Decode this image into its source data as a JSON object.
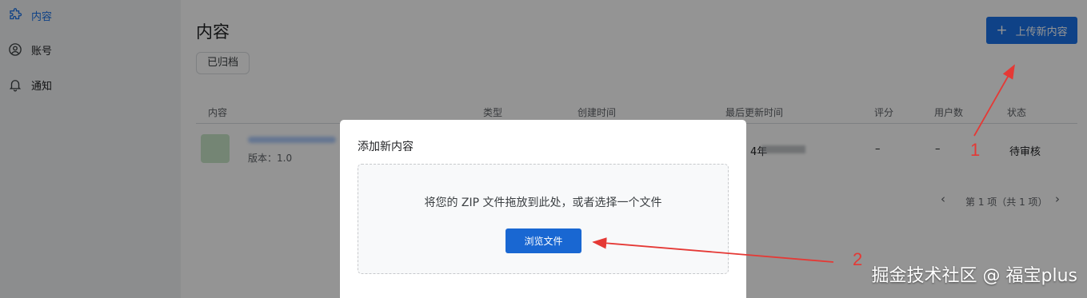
{
  "sidebar": {
    "items": [
      {
        "label": "内容",
        "icon": "puzzle-icon",
        "active": true
      },
      {
        "label": "账号",
        "icon": "account-circle-icon"
      },
      {
        "label": "通知",
        "icon": "bell-icon"
      }
    ]
  },
  "header": {
    "title": "内容",
    "archived_chip": "已归档",
    "upload_button": "上传新内容",
    "upload_icon": "+"
  },
  "table": {
    "columns": [
      "内容",
      "类型",
      "创建时间",
      "最后更新时间",
      "评分",
      "用户数",
      "状态"
    ],
    "row": {
      "version": "版本：1.0",
      "updated_prefix": "4年",
      "rating": "–",
      "users": "–",
      "status": "待审核"
    },
    "pagination": {
      "prev": "‹",
      "label": "第 1 项（共 1 项）",
      "next": "›"
    }
  },
  "dialog": {
    "title": "添加新内容",
    "dropzone_text": "将您的 ZIP 文件拖放到此处，或者选择一个文件",
    "browse_button": "浏览文件"
  },
  "annotations": {
    "label_1": "1",
    "label_2": "2",
    "color": "#e53935"
  },
  "watermark": "掘金技术社区 @ 福宝plus",
  "colors": {
    "primary": "#1a73e8",
    "browse": "#1967d2"
  }
}
